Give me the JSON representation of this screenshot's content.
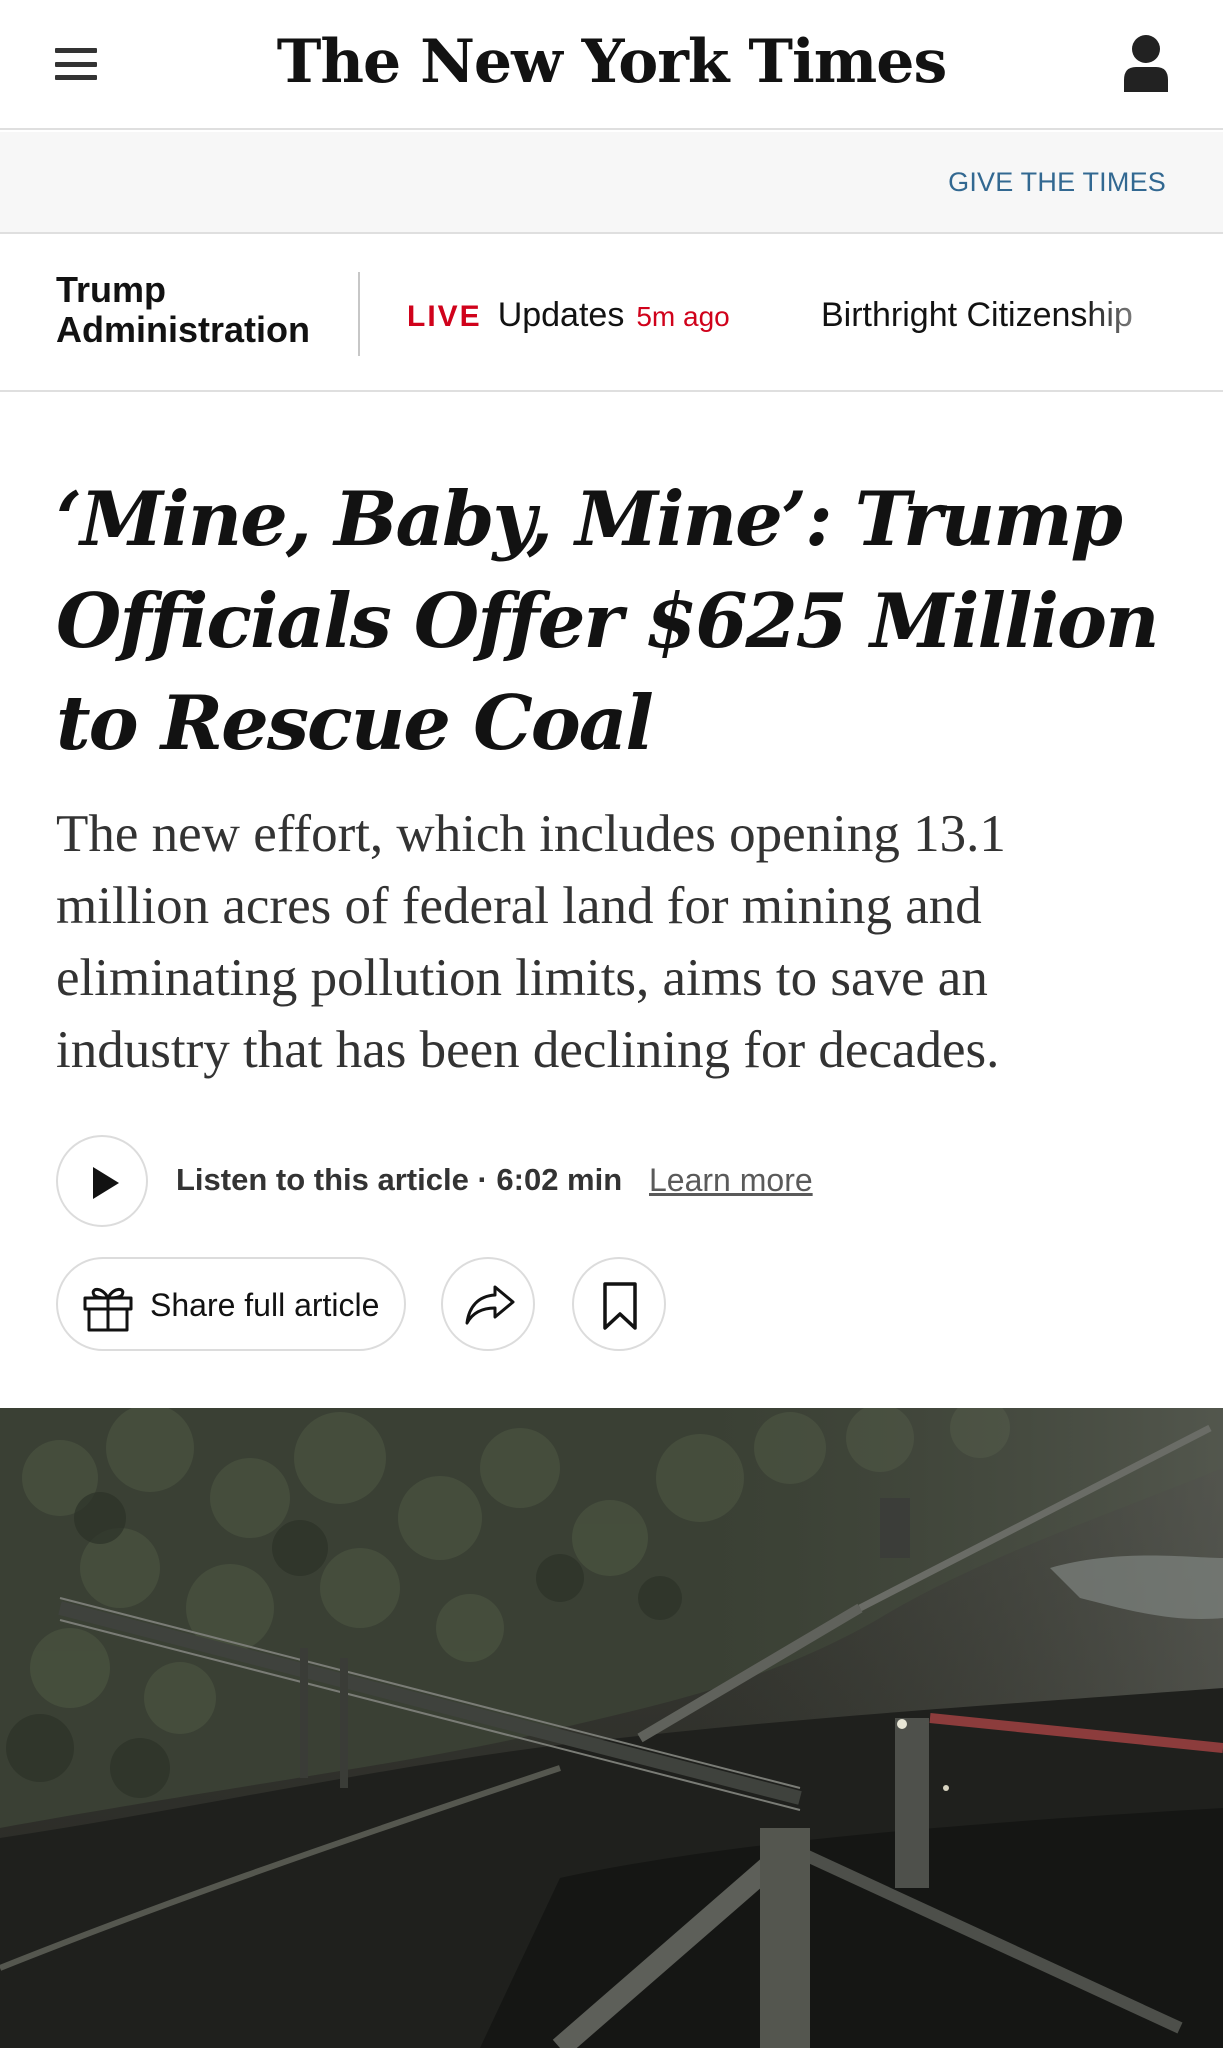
{
  "masthead": {
    "logo_text": "The New York Times"
  },
  "gift_bar": {
    "link_label": "GIVE THE TIMES"
  },
  "section_nav": {
    "section_label": "Trump\nAdministration",
    "live_badge": "LIVE",
    "live_text": "Updates",
    "live_time": "5m ago",
    "link_1": "Birthright Citizenship"
  },
  "article": {
    "headline": "‘Mine, Baby, Mine’: Trump Officials Offer $625 Million to Rescue Coal",
    "summary": "The new effort, which includes opening 13.1 million acres of federal land for mining and eliminating pollution limits, aims to save an industry that has been declining for decades."
  },
  "audio": {
    "listen_label": "Listen to this article · 6:02 min",
    "learn_more": "Learn more"
  },
  "share": {
    "share_full_label": "Share full article"
  },
  "icons": {
    "menu": "hamburger-menu-icon",
    "account": "user-account-icon",
    "play": "play-icon",
    "gift": "gift-icon",
    "share": "share-arrow-icon",
    "save": "bookmark-icon"
  },
  "colors": {
    "accent_blue": "#326891",
    "live_red": "#d0021b",
    "text_dark": "#121212",
    "border_gray": "#dfdfdf"
  }
}
